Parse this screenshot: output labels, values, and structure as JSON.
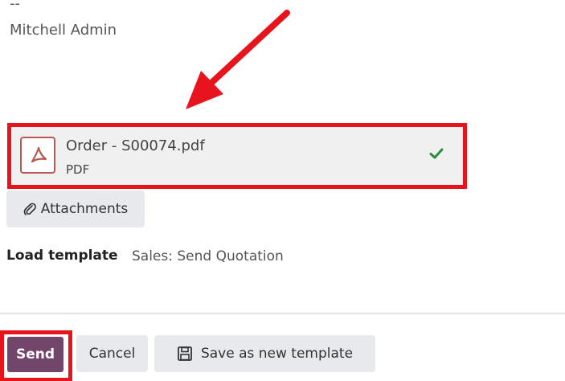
{
  "signature": {
    "dashes": "--",
    "name": "Mitchell Admin"
  },
  "attachment": {
    "file_name": "Order - S00074.pdf",
    "file_type": "PDF",
    "icon": "pdf-icon",
    "status_icon": "check-icon"
  },
  "attachments_button": {
    "label": "Attachments",
    "icon": "paperclip-icon"
  },
  "template": {
    "label": "Load template",
    "value": "Sales: Send Quotation"
  },
  "footer": {
    "send_label": "Send",
    "cancel_label": "Cancel",
    "save_template_label": "Save as new template",
    "save_icon": "floppy-disk-icon"
  },
  "colors": {
    "highlight": "#e8141d",
    "send_button": "#71466a",
    "check": "#2e8b3a",
    "pdf_icon": "#b85a52"
  }
}
